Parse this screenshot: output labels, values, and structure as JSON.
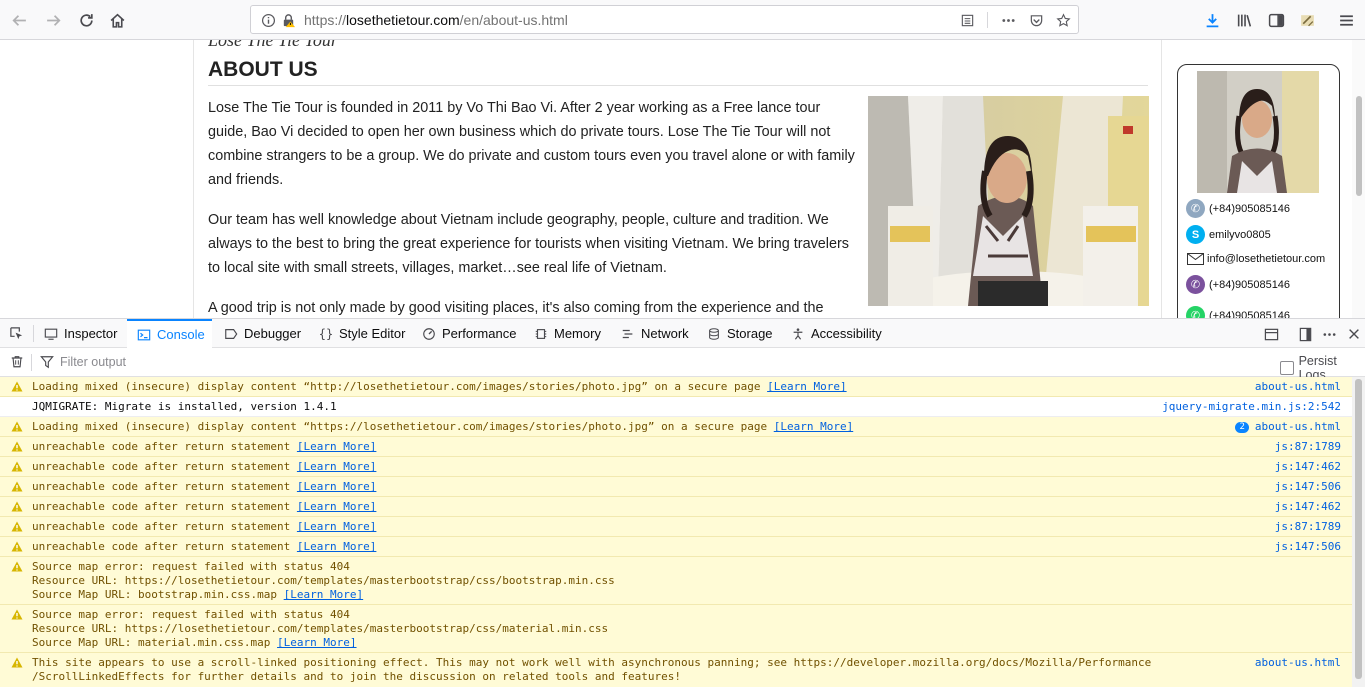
{
  "browser": {
    "url_prefix": "https://",
    "url_domain": "losethetietour.com",
    "url_path": "/en/about-us.html"
  },
  "page": {
    "cut_heading": "Lose The Tie Tour",
    "title": "ABOUT US",
    "paragraphs": [
      "Lose The Tie Tour is founded in 2011 by Vo Thi Bao Vi. After 2 year working as a Free lance tour guide, Bao Vi decided to open her own business which do private tours. Lose The Tie Tour will not combine strangers to be a group. We do private and custom tours even you travel alone or with family and friends.",
      "Our team has well knowledge about Vietnam include geography, people, culture and tradition. We always to the best to bring the great experience for tourists when visiting Vietnam. We bring travelers to local site with small streets, villages, market…see real life of Vietnam.",
      "A good trip is not only made by good visiting places, it's also coming from the experience and the"
    ],
    "contacts": {
      "phone": "(+84)905085146",
      "skype": "emilyvo0805",
      "email": "info@losethetietour.com",
      "viber": "(+84)905085146",
      "whatsapp": "(+84)905085146"
    }
  },
  "devtools": {
    "tabs": [
      "Inspector",
      "Console",
      "Debugger",
      "Style Editor",
      "Performance",
      "Memory",
      "Network",
      "Storage",
      "Accessibility"
    ],
    "filter_placeholder": "Filter output",
    "persist_label": "Persist Logs",
    "learn_more": "[Learn More]",
    "messages": [
      {
        "type": "warn",
        "text": "Loading mixed (insecure) display content “http://losethetietour.com/images/stories/photo.jpg” on a secure page ",
        "location": "about-us.html"
      },
      {
        "type": "log",
        "text": "JQMIGRATE: Migrate is installed, version 1.4.1",
        "location": "jquery-migrate.min.js:2:542"
      },
      {
        "type": "warn",
        "text": "Loading mixed (insecure) display content “https://losethetietour.com/images/stories/photo.jpg” on a secure page ",
        "location": "about-us.html",
        "count": "2"
      },
      {
        "type": "warn",
        "text": "unreachable code after return statement ",
        "location": "js:87:1789"
      },
      {
        "type": "warn",
        "text": "unreachable code after return statement ",
        "location": "js:147:462"
      },
      {
        "type": "warn",
        "text": "unreachable code after return statement ",
        "location": "js:147:506"
      },
      {
        "type": "warn",
        "text": "unreachable code after return statement ",
        "location": "js:147:462"
      },
      {
        "type": "warn",
        "text": "unreachable code after return statement ",
        "location": "js:87:1789"
      },
      {
        "type": "warn",
        "text": "unreachable code after return statement ",
        "location": "js:147:506"
      },
      {
        "type": "warn",
        "line1": "Source map error: request failed with status 404",
        "line2": "Resource URL: https://losethetietour.com/templates/masterbootstrap/css/bootstrap.min.css",
        "line3": "Source Map URL: bootstrap.min.css.map "
      },
      {
        "type": "warn",
        "line1": "Source map error: request failed with status 404",
        "line2": "Resource URL: https://losethetietour.com/templates/masterbootstrap/css/material.min.css",
        "line3": "Source Map URL: material.min.css.map "
      },
      {
        "type": "warn",
        "line1": "This site appears to use a scroll-linked positioning effect. This may not work well with asynchronous panning; see https://developer.mozilla.org/docs/Mozilla/Performance",
        "line2": "/ScrollLinkedEffects for further details and to join the discussion on related tools and features!",
        "location": "about-us.html"
      }
    ]
  }
}
